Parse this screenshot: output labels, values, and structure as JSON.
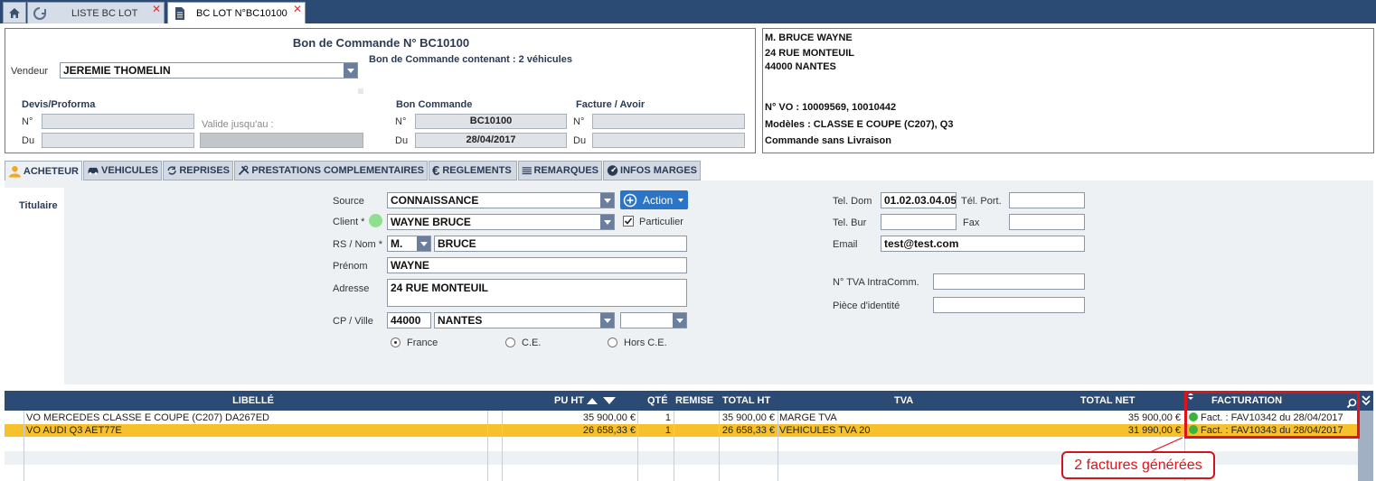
{
  "topbar": {
    "tabs": [
      {
        "label": "LISTE BC LOT",
        "close": "✕"
      },
      {
        "label": "BC LOT N°BC10100",
        "close": "✕"
      }
    ]
  },
  "header": {
    "title": "Bon de Commande N° BC10100",
    "subtitle": "Bon de Commande contenant : 2 véhicules",
    "vendeur_label": "Vendeur",
    "vendeur_value": "JEREMIE THOMELIN",
    "devis_title": "Devis/Proforma",
    "bon_title": "Bon Commande",
    "facture_title": "Facture / Avoir",
    "num_label": "N°",
    "du_label": "Du",
    "valide_label": "Valide jusqu'au :",
    "bon_num": "BC10100",
    "bon_date": "28/04/2017"
  },
  "client_box": {
    "name": "M. BRUCE WAYNE",
    "street": "24 RUE MONTEUIL",
    "city": "44000 NANTES",
    "vo": "N° VO : 10009569, 10010442",
    "modeles": "Modèles : CLASSE E COUPE (C207), Q3",
    "livraison": "Commande sans Livraison"
  },
  "section_tabs": [
    "ACHETEUR",
    "VEHICULES",
    "REPRISES",
    "PRESTATIONS COMPLEMENTAIRES",
    "REGLEMENTS",
    "REMARQUES",
    "INFOS MARGES"
  ],
  "acheteur": {
    "side_tab": "Titulaire",
    "source_label": "Source",
    "source_value": "CONNAISSANCE",
    "action_label": "Action",
    "client_label": "Client *",
    "client_value": "WAYNE BRUCE",
    "particulier_label": "Particulier",
    "rs_label": "RS / Nom *",
    "civilite": "M.",
    "nom": "BRUCE",
    "prenom_label": "Prénom",
    "prenom": "WAYNE",
    "adresse_label": "Adresse",
    "adresse": "24 RUE MONTEUIL",
    "cp_label": "CP / Ville",
    "cp": "44000",
    "ville": "NANTES",
    "radio_france": "France",
    "radio_ce": "C.E.",
    "radio_hors": "Hors C.E.",
    "tel_dom_label": "Tel. Dom",
    "tel_dom": "01.02.03.04.05",
    "tel_port_label": "Tél. Port.",
    "tel_bur_label": "Tel. Bur",
    "fax_label": "Fax",
    "email_label": "Email",
    "email": "test@test.com",
    "tva_label": "N° TVA IntraComm.",
    "piece_label": "Pièce d'identité"
  },
  "grid": {
    "headers": {
      "libelle": "LIBELLÉ",
      "pu_ht": "PU HT",
      "qte": "QTÉ",
      "remise": "REMISE",
      "total_ht": "TOTAL HT",
      "tva": "TVA",
      "total_net": "TOTAL NET",
      "facturation": "FACTURATION"
    },
    "rows": [
      {
        "libelle": "VO MERCEDES CLASSE E COUPE (C207) DA267ED",
        "pu_ht": "35 900,00 €",
        "qte": "1",
        "total_ht": "35 900,00 €",
        "tva": "MARGE TVA",
        "total_net": "35 900,00 €",
        "facturation": "Fact. : FAV10342 du 28/04/2017"
      },
      {
        "libelle": "VO AUDI Q3 AET77E",
        "pu_ht": "26 658,33 €",
        "qte": "1",
        "total_ht": "26 658,33 €",
        "tva": "VEHICULES TVA 20",
        "total_net": "31 990,00 €",
        "facturation": "Fact. : FAV10343 du 28/04/2017"
      }
    ]
  },
  "callout": "2 factures générées",
  "colors": {
    "navy": "#2b4a74",
    "selected_row": "#f7c12e",
    "highlight": "#e0121b",
    "green": "#3cb43c"
  }
}
